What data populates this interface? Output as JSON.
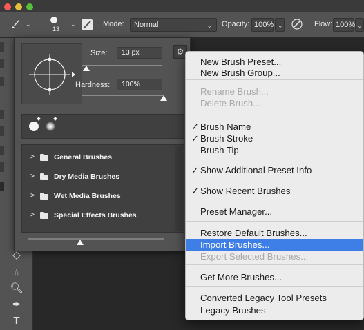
{
  "options_bar": {
    "brush_size": "13",
    "mode_label": "Mode:",
    "mode_value": "Normal",
    "opacity_label": "Opacity:",
    "opacity_value": "100%",
    "flow_label": "Flow:",
    "flow_value": "100%"
  },
  "brush_panel": {
    "size_label": "Size:",
    "size_value": "13 px",
    "size_fraction": 0.05,
    "hardness_label": "Hardness:",
    "hardness_value": "100%",
    "hardness_fraction": 1.0,
    "folders": [
      {
        "label": "General Brushes"
      },
      {
        "label": "Dry Media Brushes"
      },
      {
        "label": "Wet Media Brushes"
      },
      {
        "label": "Special Effects Brushes"
      }
    ]
  },
  "menu": {
    "items": [
      {
        "label": "New Brush Preset...",
        "enabled": true,
        "checked": false
      },
      {
        "label": "New Brush Group...",
        "enabled": true,
        "checked": false
      },
      {
        "label": "Rename Brush...",
        "enabled": false,
        "checked": false
      },
      {
        "label": "Delete Brush...",
        "enabled": false,
        "checked": false
      },
      {
        "label": "Brush Name",
        "enabled": true,
        "checked": true
      },
      {
        "label": "Brush Stroke",
        "enabled": true,
        "checked": true
      },
      {
        "label": "Brush Tip",
        "enabled": true,
        "checked": false
      },
      {
        "label": "Show Additional Preset Info",
        "enabled": true,
        "checked": true
      },
      {
        "label": "Show Recent Brushes",
        "enabled": true,
        "checked": true
      },
      {
        "label": "Preset Manager...",
        "enabled": true,
        "checked": false
      },
      {
        "label": "Restore Default Brushes...",
        "enabled": true,
        "checked": false
      },
      {
        "label": "Import Brushes...",
        "enabled": true,
        "checked": false,
        "highlighted": true
      },
      {
        "label": "Export Selected Brushes...",
        "enabled": false,
        "checked": false
      },
      {
        "label": "Get More Brushes...",
        "enabled": true,
        "checked": false
      },
      {
        "label": "Converted Legacy Tool Presets",
        "enabled": true,
        "checked": false
      },
      {
        "label": "Legacy Brushes",
        "enabled": true,
        "checked": false
      }
    ],
    "check_glyph": "✓"
  },
  "colors": {
    "menu_highlight": "#3d7fe6",
    "panel_bg": "#535353",
    "menu_bg": "#ececec"
  }
}
